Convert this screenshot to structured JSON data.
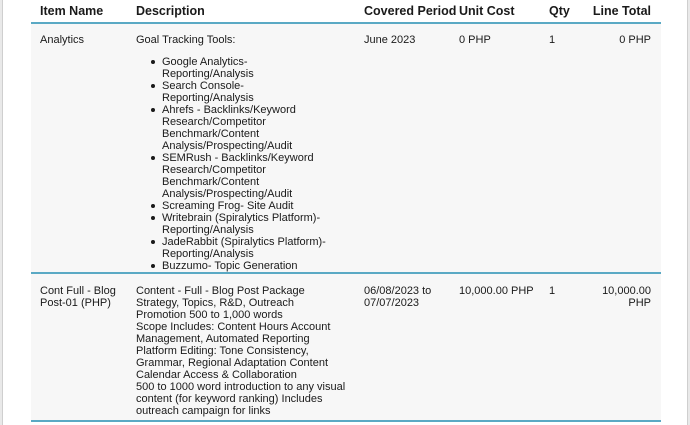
{
  "table": {
    "headers": {
      "item_name": "Item Name",
      "description": "Description",
      "covered_period": "Covered Period",
      "unit_cost": "Unit Cost",
      "qty": "Qty",
      "line_total": "Line Total"
    },
    "rows": [
      {
        "item_name": "Analytics",
        "description_intro": "Goal Tracking Tools:",
        "description_items": [
          "Google Analytics- Reporting/Analysis",
          "Search Console- Reporting/Analysis",
          "Ahrefs - Backlinks/Keyword Research/Competitor Benchmark/Content Analysis/Prospecting/Audit",
          "SEMRush - Backlinks/Keyword Research/Competitor Benchmark/Content Analysis/Prospecting/Audit",
          "Screaming Frog- Site Audit",
          "Writebrain (Spiralytics Platform)- Reporting/Analysis",
          "JadeRabbit (Spiralytics Platform)- Reporting/Analysis",
          "Buzzumo- Topic Generation"
        ],
        "covered_period": "June 2023",
        "unit_cost": "0 PHP",
        "qty": "1",
        "line_total": "0 PHP"
      },
      {
        "item_name": "Cont Full - Blog Post-01 (PHP)",
        "description_lines": [
          "Content - Full - Blog Post Package Strategy, Topics, R&D, Outreach Promotion 500 to 1,000 words",
          "Scope Includes: Content Hours Account Management, Automated Reporting Platform Editing: Tone Consistency, Grammar, Regional Adaptation Content Calendar Access & Collaboration",
          "500 to 1000 word introduction to any visual content (for keyword ranking) Includes outreach campaign for links"
        ],
        "covered_period": "06/08/2023 to 07/07/2023",
        "unit_cost": "10,000.00 PHP",
        "qty": "1",
        "line_total": "10,000.00 PHP"
      }
    ]
  }
}
